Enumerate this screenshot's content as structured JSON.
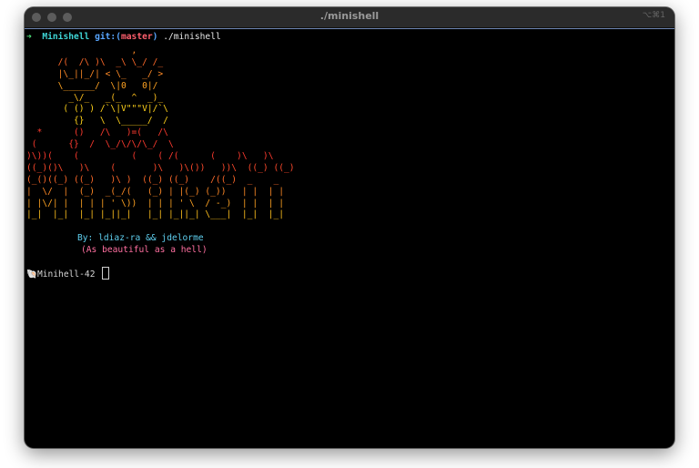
{
  "window": {
    "title": "./minishell",
    "shortcut": "⌥⌘1",
    "accent_color": "#6e86b3"
  },
  "prompt": {
    "arrow": "➜",
    "directory": "Minishell",
    "git_label": "git:(",
    "branch": "master",
    "git_close": ")",
    "command": "./minishell"
  },
  "banner": {
    "lines": [
      "                    ,",
      "      /(  /\\ )\\  _\\ \\_/ /_",
      "      |\\_||_/| < \\_   _/ >",
      "      \\______/  \\|0   0|/",
      "        _\\/_   _(_  ^  _)_",
      "       ( () ) /`\\|V\"\"\"V|/`\\",
      "         {}   \\  \\_____/  /",
      "  *      ()   /\\   )=(   /\\",
      " (      {}  /  \\_/\\/\\/\\_/  \\",
      ")\\))(    (          (    ( /(      (    )\\   )\\",
      "((_)()\\   )\\    (       )\\   )\\())   ))\\  ((_) ((_)",
      "(_()((_) ((_)   )\\ )  ((_) ((_)    /((_)  _    _",
      "|  \\/  |  (_)  _(_/(   (_) | |(_) (_))   | |  | |",
      "| |\\/| |  | | | ' \\))  | | | ' \\  / -_)  | |  | |",
      "|_|  |_|  |_| |_||_|   |_| |_||_| \\___|  |_|  |_|"
    ],
    "colors": [
      "#ff3b2f",
      "#ff4a2c",
      "#ff6a2a",
      "#ff8a26",
      "#ffa322",
      "#ffc01d",
      "#ffd21a"
    ],
    "authors": "By: ldiaz-ra && jdelorme",
    "tagline": "(As beautiful as a hell)"
  },
  "shell_prompt": {
    "icon": "shell-icon",
    "glyph": "🐚",
    "text": "Minihell-42"
  }
}
